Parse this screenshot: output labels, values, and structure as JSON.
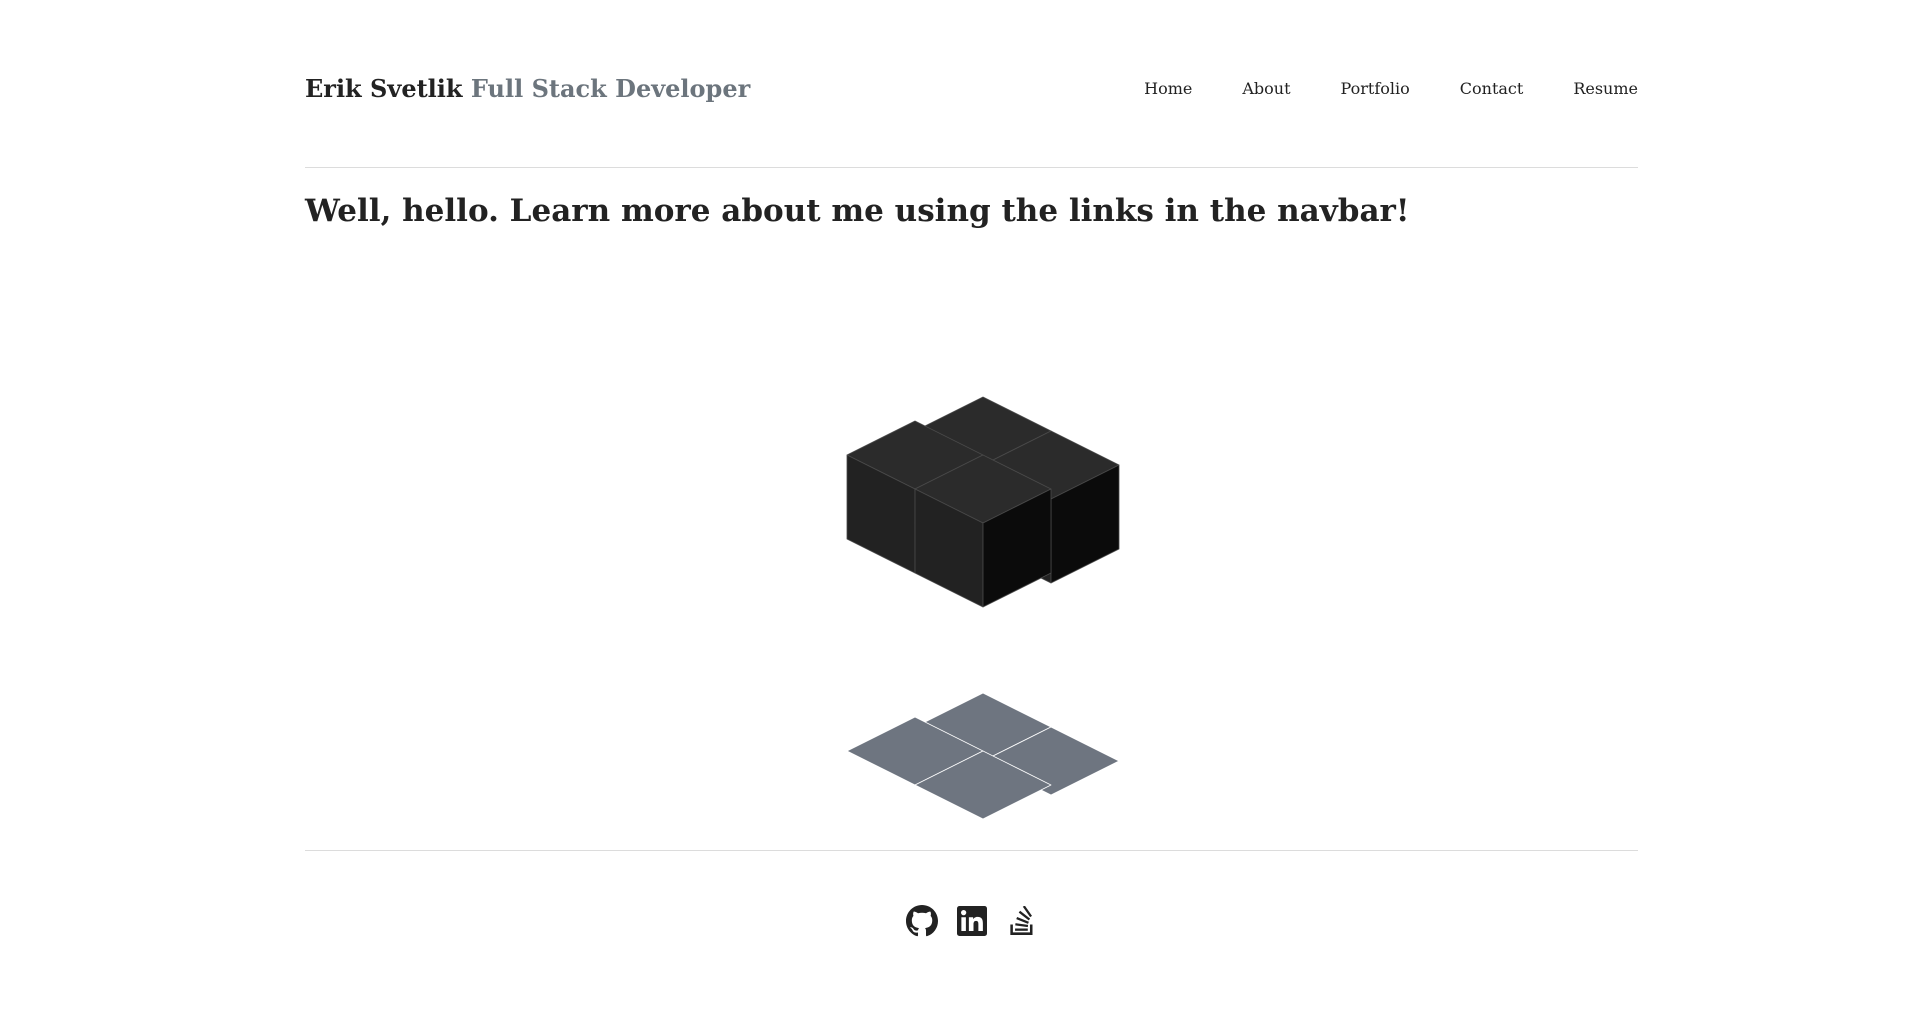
{
  "header": {
    "brand_name": "Erik Svetlik",
    "brand_role": "Full Stack Developer",
    "nav": [
      {
        "label": "Home"
      },
      {
        "label": "About"
      },
      {
        "label": "Portfolio"
      },
      {
        "label": "Contact"
      },
      {
        "label": "Resume"
      }
    ]
  },
  "main": {
    "headline": "Well, hello. Learn more about me using the links in the navbar!"
  },
  "footer": {
    "social": [
      {
        "icon": "github-icon"
      },
      {
        "icon": "linkedin-icon"
      },
      {
        "icon": "stackoverflow-icon"
      }
    ]
  },
  "colors": {
    "text": "#222222",
    "muted": "#6c757d",
    "cube_top": "#2b2b2b",
    "cube_left": "#222222",
    "cube_right": "#0b0b0b",
    "shadow": "#6e7580"
  }
}
